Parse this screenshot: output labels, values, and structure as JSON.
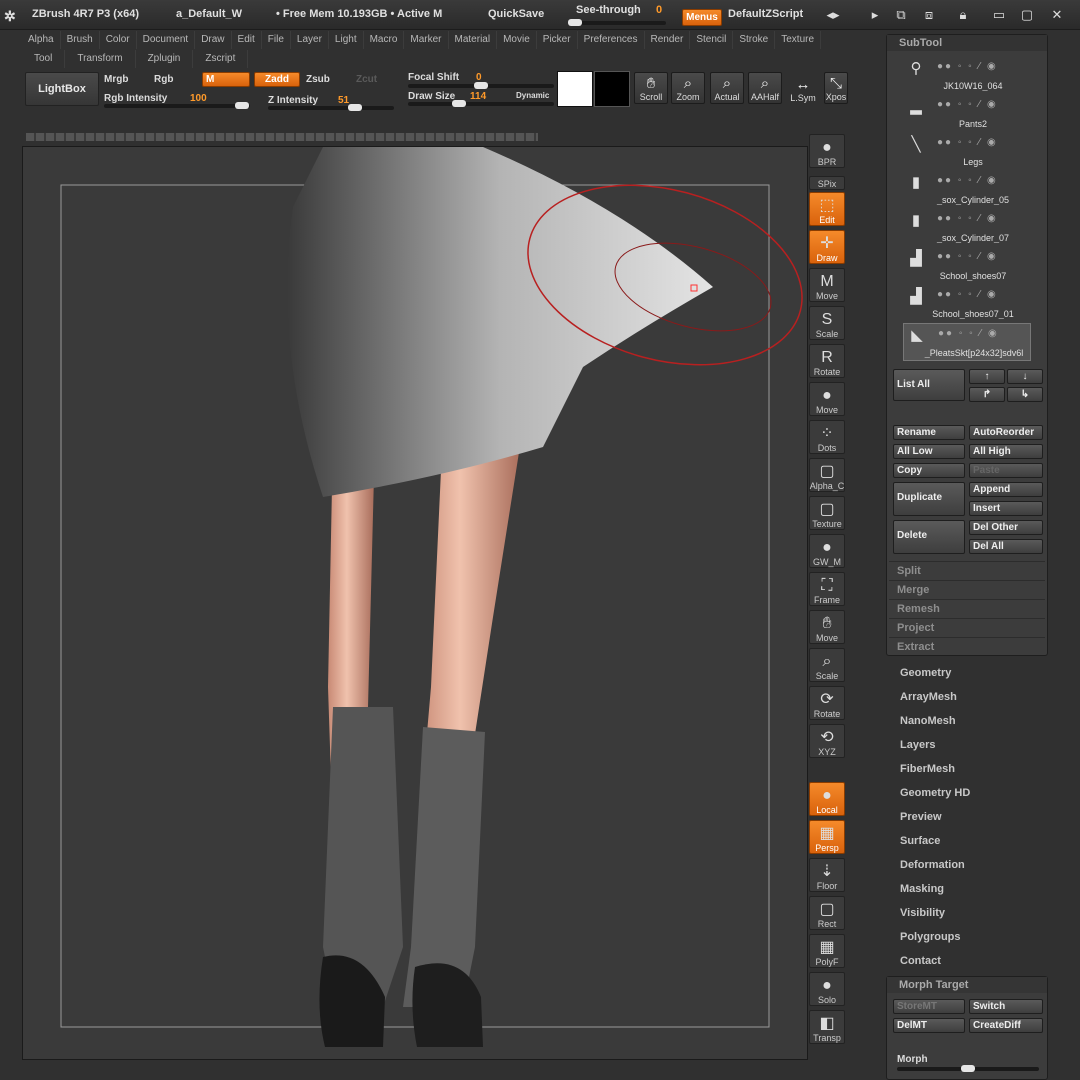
{
  "title": {
    "app": "ZBrush 4R7 P3 (x64)",
    "doc": "a_Default_W",
    "mem": "• Free Mem 10.193GB • Active M",
    "quicksave": "QuickSave",
    "seethrough": "See-through",
    "seethrough_val": "0",
    "menus": "Menus",
    "script": "DefaultZScript"
  },
  "menu_row1": [
    "Alpha",
    "Brush",
    "Color",
    "Document",
    "Draw",
    "Edit",
    "File",
    "Layer",
    "Light",
    "Macro",
    "Marker",
    "Material",
    "Movie",
    "Picker",
    "Preferences",
    "Render",
    "Stencil",
    "Stroke",
    "Texture"
  ],
  "menu_row2": [
    "Tool",
    "Transform",
    "Zplugin",
    "Zscript"
  ],
  "toolbar": {
    "lightbox": "LightBox",
    "mrgb": "Mrgb",
    "rgb": "Rgb",
    "m": "M",
    "zadd": "Zadd",
    "zsub": "Zsub",
    "zcut": "Zcut",
    "rgb_int_label": "Rgb Intensity",
    "rgb_int_val": "100",
    "z_int_label": "Z Intensity",
    "z_int_val": "51",
    "focal_label": "Focal Shift",
    "focal_val": "0",
    "draw_label": "Draw Size",
    "draw_val": "114",
    "dynamic": "Dynamic",
    "scroll": "Scroll",
    "zoom": "Zoom",
    "actual": "Actual",
    "aahalf": "AAHalf",
    "lsym": "L.Sym",
    "xpos": "Xpos"
  },
  "shelf": [
    "BPR",
    "SPix",
    "Edit",
    "Draw",
    "Move",
    "Scale",
    "Rotate",
    "Move",
    "Dots",
    "Alpha_C",
    "Texture",
    "GW_M",
    "Frame",
    "Move",
    "Scale",
    "Rotate",
    "XYZ",
    "Local",
    "Persp",
    "Floor",
    "Rect",
    "PolyF",
    "Solo",
    "Transp"
  ],
  "subtool": {
    "title": "SubTool",
    "items": [
      "JK10W16_064",
      "Pants2",
      "Legs",
      "_sox_Cylinder_05",
      "_sox_Cylinder_07",
      "School_shoes07",
      "School_shoes07_01",
      "_PleatsSkt[p24x32]sdv6l"
    ],
    "list_all": "List All",
    "rename": "Rename",
    "autoreorder": "AutoReorder",
    "all_low": "All Low",
    "all_high": "All High",
    "copy": "Copy",
    "paste": "Paste",
    "duplicate": "Duplicate",
    "append": "Append",
    "insert": "Insert",
    "delete": "Delete",
    "del_other": "Del Other",
    "del_all": "Del All",
    "groups": [
      "Split",
      "Merge",
      "Remesh",
      "Project",
      "Extract"
    ]
  },
  "sections": [
    "Geometry",
    "ArrayMesh",
    "NanoMesh",
    "Layers",
    "FiberMesh",
    "Geometry HD",
    "Preview",
    "Surface",
    "Deformation",
    "Masking",
    "Visibility",
    "Polygroups",
    "Contact"
  ],
  "morph": {
    "title": "Morph Target",
    "storemt": "StoreMT",
    "switch": "Switch",
    "delmt": "DelMT",
    "creatediff": "CreateDiff",
    "morph": "Morph"
  }
}
